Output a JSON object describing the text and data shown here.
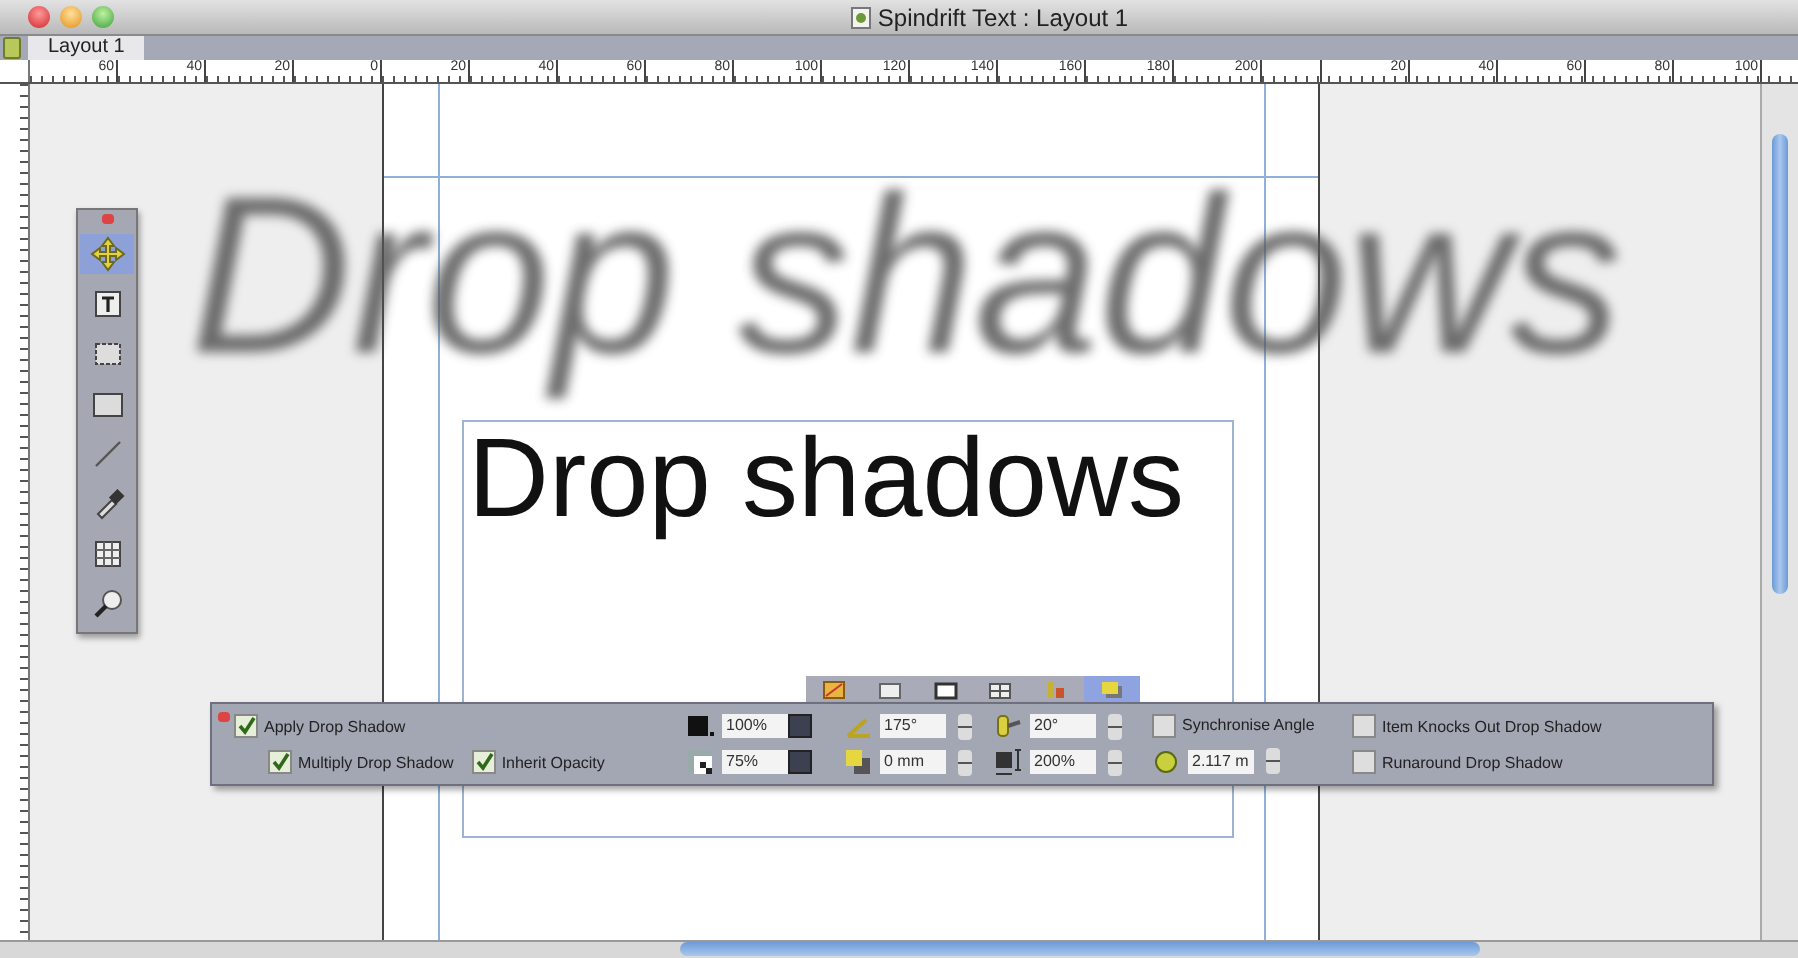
{
  "window": {
    "title": "Spindrift Text : Layout 1"
  },
  "tabs": [
    {
      "label": "Layout 1",
      "selected": true
    }
  ],
  "ruler": {
    "pages": [
      {
        "labels": [
          "60",
          "40",
          "20",
          "0",
          "20",
          "40",
          "60",
          "80",
          "100",
          "120",
          "140",
          "160",
          "180",
          "200"
        ]
      },
      {
        "labels": [
          "20",
          "40",
          "60",
          "80",
          "100"
        ]
      }
    ]
  },
  "tools": [
    {
      "kind": "move",
      "selected": true
    },
    {
      "kind": "text",
      "selected": false
    },
    {
      "kind": "picture",
      "selected": false
    },
    {
      "kind": "box",
      "selected": false
    },
    {
      "kind": "line",
      "selected": false
    },
    {
      "kind": "eyedropper",
      "selected": false
    },
    {
      "kind": "table",
      "selected": false
    },
    {
      "kind": "zoom",
      "selected": false
    }
  ],
  "canvas": {
    "shadow_text": "Drop shadows",
    "text": "Drop shadows"
  },
  "palette": {
    "tabs": [
      {
        "kind": "classic",
        "selected": false
      },
      {
        "kind": "frame",
        "selected": false
      },
      {
        "kind": "box",
        "selected": false
      },
      {
        "kind": "grid",
        "selected": false
      },
      {
        "kind": "chart",
        "selected": false
      },
      {
        "kind": "shadow",
        "selected": true
      }
    ],
    "apply": {
      "label": "Apply Drop Shadow",
      "checked": true
    },
    "multiply": {
      "label": "Multiply Drop Shadow",
      "checked": true
    },
    "inherit": {
      "label": "Inherit Opacity",
      "checked": true
    },
    "fields": [
      {
        "kind": "color",
        "value": "100%"
      },
      {
        "kind": "angle",
        "value": "175°"
      },
      {
        "kind": "skew",
        "value": "20°"
      },
      {
        "kind": "opacity",
        "value": "75%"
      },
      {
        "kind": "offset",
        "value": "0 mm"
      },
      {
        "kind": "scale",
        "value": "200%"
      }
    ],
    "sync": {
      "label": "Synchronise Angle",
      "checked": false
    },
    "blur": {
      "value": "2.117 m"
    },
    "knockout": {
      "label": "Item Knocks Out Drop Shadow",
      "checked": false
    },
    "runaround": {
      "label": "Runaround Drop Shadow",
      "checked": false
    }
  }
}
